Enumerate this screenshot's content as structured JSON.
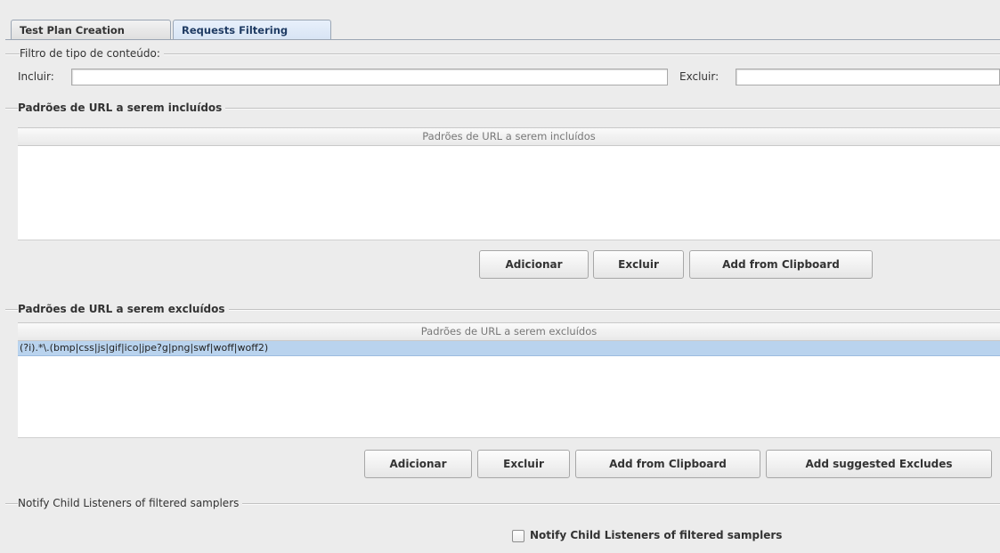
{
  "tabs": [
    {
      "label": "Test Plan Creation",
      "active": false
    },
    {
      "label": "Requests Filtering",
      "active": true
    }
  ],
  "content_type_filter": {
    "title": "Filtro de tipo de conteúdo:",
    "include_label": "Incluir:",
    "include_value": "",
    "exclude_label": "Excluir:",
    "exclude_value": ""
  },
  "include_patterns": {
    "title": "Padrões de URL a serem incluídos",
    "column_header": "Padrões de URL a serem incluídos",
    "rows": [],
    "buttons": {
      "add": "Adicionar",
      "delete": "Excluir",
      "add_from_clipboard": "Add from Clipboard"
    }
  },
  "exclude_patterns": {
    "title": "Padrões de URL a serem excluídos",
    "column_header": "Padrões de URL a serem excluídos",
    "rows": [
      "(?i).*\\.(bmp|css|js|gif|ico|jpe?g|png|swf|woff|woff2)"
    ],
    "selected_row": 0,
    "buttons": {
      "add": "Adicionar",
      "delete": "Excluir",
      "add_from_clipboard": "Add from Clipboard",
      "add_suggested": "Add suggested Excludes"
    }
  },
  "notify": {
    "title": "Notify Child Listeners of filtered samplers",
    "checkbox_label": "Notify Child Listeners of filtered samplers",
    "checked": false
  },
  "colors": {
    "panel_background": "#ececec",
    "selection_row": "#b9d3ee",
    "active_tab": "#d7e4f4"
  }
}
